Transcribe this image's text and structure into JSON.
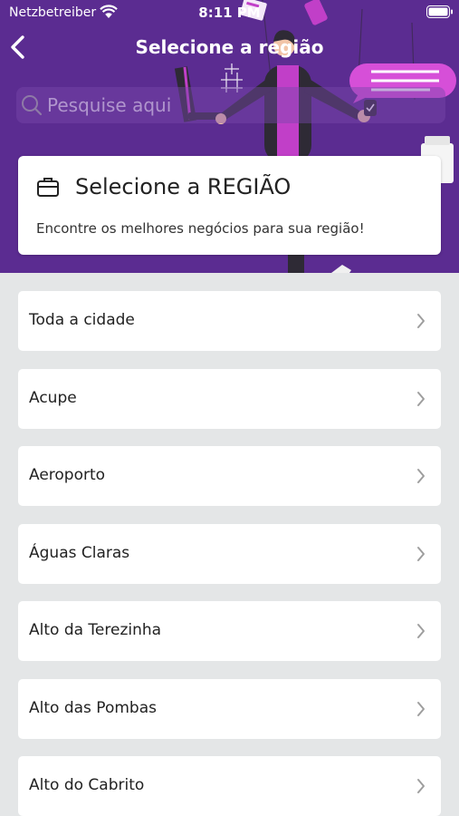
{
  "status_bar": {
    "carrier": "Netzbetreiber",
    "time": "8:11 PM",
    "wifi_icon": "wifi-icon",
    "battery_icon": "battery-icon"
  },
  "header": {
    "title": "Selecione a região",
    "back_icon": "chevron-left-icon",
    "background_color": "#5b2c91"
  },
  "search": {
    "placeholder": "Pesquise aqui",
    "value": "",
    "icon": "search-icon"
  },
  "info_card": {
    "icon": "briefcase-icon",
    "title": "Selecione a REGIÃO",
    "subtitle": "Encontre os melhores negócios para sua região!"
  },
  "regions": [
    {
      "label": "Toda a cidade"
    },
    {
      "label": "Acupe"
    },
    {
      "label": "Aeroporto"
    },
    {
      "label": "Águas Claras"
    },
    {
      "label": "Alto da Terezinha"
    },
    {
      "label": "Alto das Pombas"
    },
    {
      "label": "Alto do Cabrito"
    }
  ],
  "colors": {
    "accent": "#5b2c91",
    "illustration_accent": "#c13fc8",
    "list_background": "#e4e6e7"
  }
}
